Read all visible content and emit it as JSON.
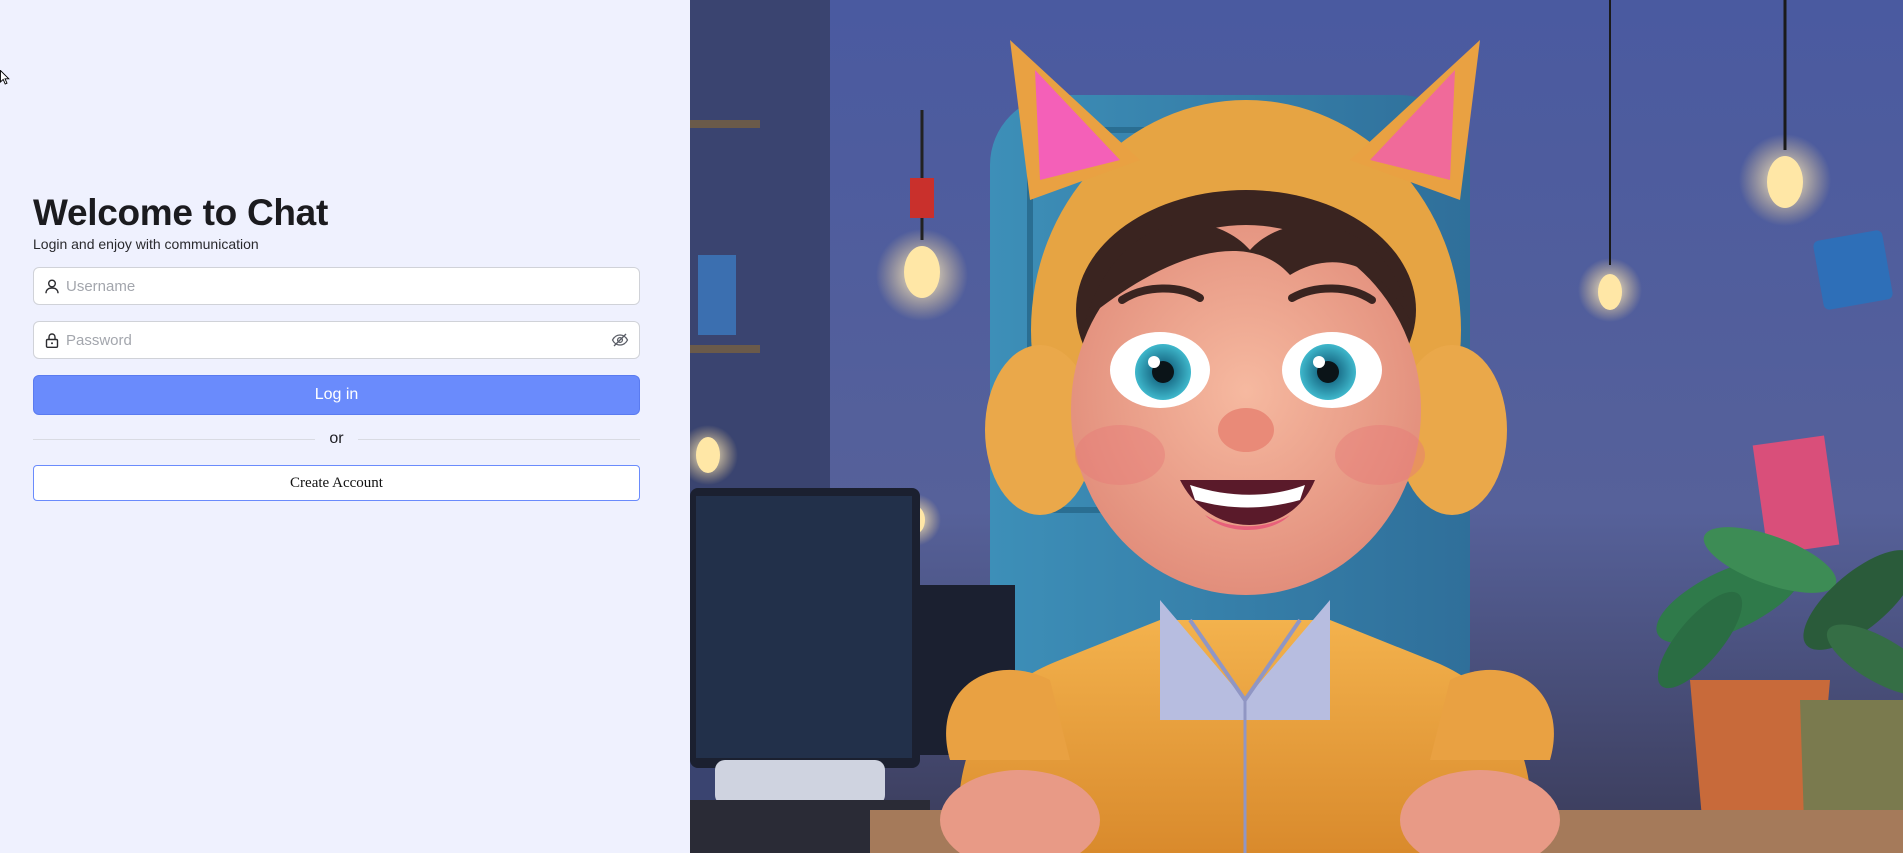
{
  "login": {
    "title": "Welcome to Chat",
    "subtitle": "Login and enjoy with communication",
    "username_placeholder": "Username",
    "username_value": "",
    "password_placeholder": "Password",
    "password_value": "",
    "login_label": "Log in",
    "divider_text": "or",
    "create_account_label": "Create Account"
  },
  "icons": {
    "username": "user-icon",
    "password": "lock-icon",
    "toggle_password": "eye-slash-icon"
  },
  "colors": {
    "left_background": "#eff1fe",
    "accent": "#6a8bfc"
  }
}
